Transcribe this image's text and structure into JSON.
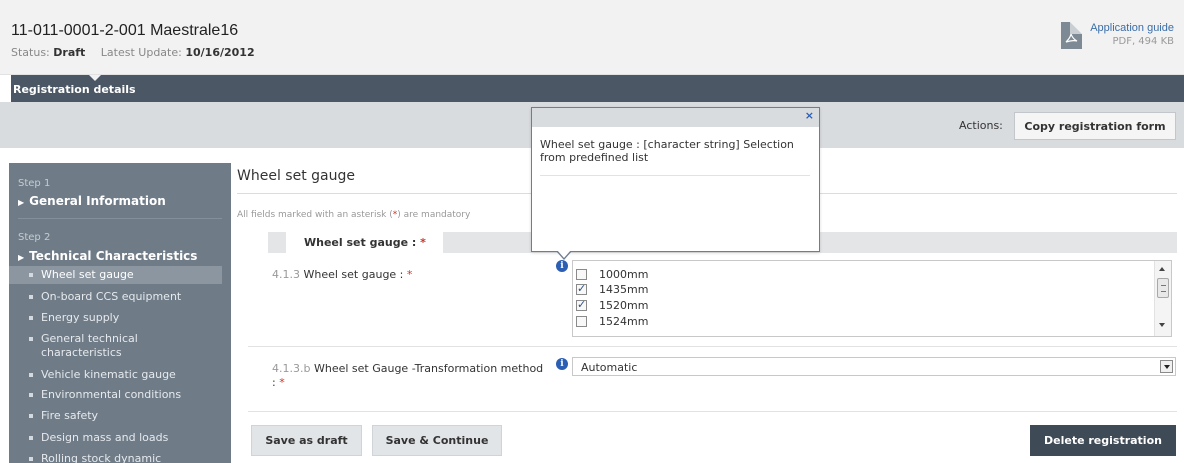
{
  "header": {
    "title": "11-011-0001-2-001 Maestrale16",
    "status_label": "Status:",
    "status_value": "Draft",
    "update_label": "Latest Update:",
    "update_value": "10/16/2012",
    "guide_title": "Application guide",
    "guide_meta": "PDF, 494 KB",
    "guide_icon": "pdf-file-icon"
  },
  "tabs": {
    "active_label": "Registration details"
  },
  "actions": {
    "label": "Actions:",
    "copy_label": "Copy registration form"
  },
  "sidebar": {
    "step1_label": "Step 1",
    "step1_title": "General Information",
    "step2_label": "Step 2",
    "step2_title": "Technical Characteristics",
    "items": [
      {
        "label": "Wheel set gauge",
        "active": true
      },
      {
        "label": "On-board CCS equipment"
      },
      {
        "label": "Energy supply"
      },
      {
        "label": "General technical characteristics"
      },
      {
        "label": "Vehicle kinematic gauge"
      },
      {
        "label": "Environmental conditions"
      },
      {
        "label": "Fire safety"
      },
      {
        "label": "Design mass and loads"
      },
      {
        "label": "Rolling stock dynamic"
      }
    ]
  },
  "main": {
    "section_title": "Wheel set gauge",
    "mandatory_pre": "All fields marked with an asterisk (",
    "mandatory_ast": "*",
    "mandatory_post": ") are mandatory",
    "field_header": "Wheel set gauge :",
    "required_mark": "*",
    "field1": {
      "code": "4.1.3",
      "label": "Wheel set gauge :",
      "options": [
        {
          "label": "1000mm",
          "checked": false
        },
        {
          "label": "1435mm",
          "checked": true
        },
        {
          "label": "1520mm",
          "checked": true
        },
        {
          "label": "1524mm",
          "checked": false
        }
      ]
    },
    "field2": {
      "code": "4.1.3.b",
      "label": "Wheel set Gauge -Transformation method",
      "label_tail": ":",
      "value": "Automatic"
    },
    "info_glyph": "i"
  },
  "buttons": {
    "save_draft": "Save as draft",
    "save_continue": "Save & Continue",
    "delete": "Delete registration"
  },
  "tooltip": {
    "close_glyph": "×",
    "text": "Wheel set gauge : [character string] Selection from predefined list"
  },
  "colors": {
    "header_bg": "#f2f2f2",
    "tab_bg": "#4b5765",
    "sidebar_bg": "#6f7b87",
    "dark_button": "#3f4a57",
    "required": "#c0392b",
    "info_blue": "#2c5fb3"
  }
}
